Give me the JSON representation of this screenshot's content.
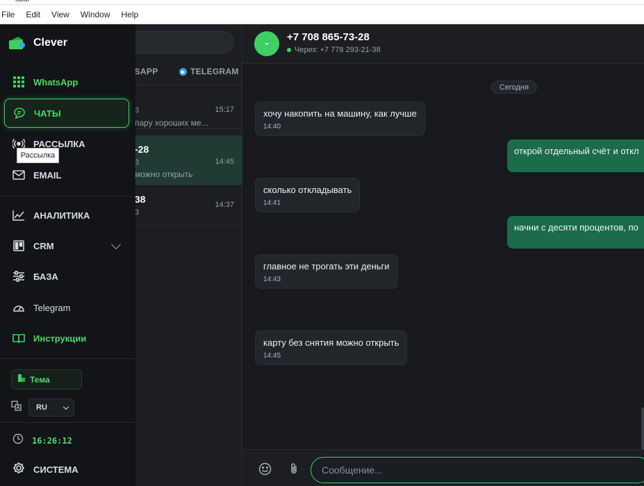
{
  "window": {
    "title": "latui"
  },
  "menubar": {
    "items": [
      "File",
      "Edit",
      "View",
      "Window",
      "Help"
    ]
  },
  "sidebar": {
    "brand": "Clever",
    "items": [
      {
        "label": "WhatsApp",
        "icon": "grid-icon"
      },
      {
        "label": "ЧАТЫ",
        "icon": "chat-bubble-icon"
      },
      {
        "label": "РАССЫЛКА",
        "icon": "broadcast-icon"
      },
      {
        "label": "EMAIL",
        "icon": "mail-icon"
      },
      {
        "label": "АНАЛИТИКА",
        "icon": "chart-line-icon"
      },
      {
        "label": "CRM",
        "icon": "board-icon"
      },
      {
        "label": "БАЗА",
        "icon": "sliders-icon"
      },
      {
        "label": "Telegram",
        "icon": "gauge-icon"
      },
      {
        "label": "Инструкции",
        "icon": "book-icon"
      }
    ],
    "tooltip": "Рассылка",
    "theme_label": "Тема",
    "language": "RU",
    "clock": "16:26:12",
    "system_label": "СИСТЕМА"
  },
  "chat_list": {
    "tabs": [
      "TSAPP",
      "TELEGRAM"
    ],
    "conversations": [
      {
        "name": "",
        "sub": "3",
        "preview": "пару хороших ме...",
        "time": "15:17"
      },
      {
        "name": "-28",
        "sub": "3",
        "preview": "можно открыть",
        "time": "14:45"
      },
      {
        "name": "38",
        "sub": "3",
        "preview": "",
        "time": "14:37"
      }
    ]
  },
  "conversation": {
    "avatar": "-",
    "phone": "+7 708 865-73-28",
    "via": "Через: +7 778 293-21-38",
    "day": "Сегодня",
    "messages": [
      {
        "dir": "in",
        "text": "хочу накопить на машину, как лучше",
        "time": "14:40"
      },
      {
        "dir": "out",
        "text": "открой отдельный счёт и откл"
      },
      {
        "dir": "in",
        "text": "сколько откладывать",
        "time": "14:41"
      },
      {
        "dir": "out",
        "text": "начни с десяти процентов, по"
      },
      {
        "dir": "in",
        "text": "главное не трогать эти деньги",
        "time": "14:43"
      },
      {
        "dir": "in",
        "text": "карту без снятия можно открыть",
        "time": "14:45"
      }
    ],
    "input_placeholder": "Сообщение..."
  },
  "colors": {
    "accent": "#3ed062",
    "outgoing": "#1c6b4b",
    "background": "#17191d"
  }
}
